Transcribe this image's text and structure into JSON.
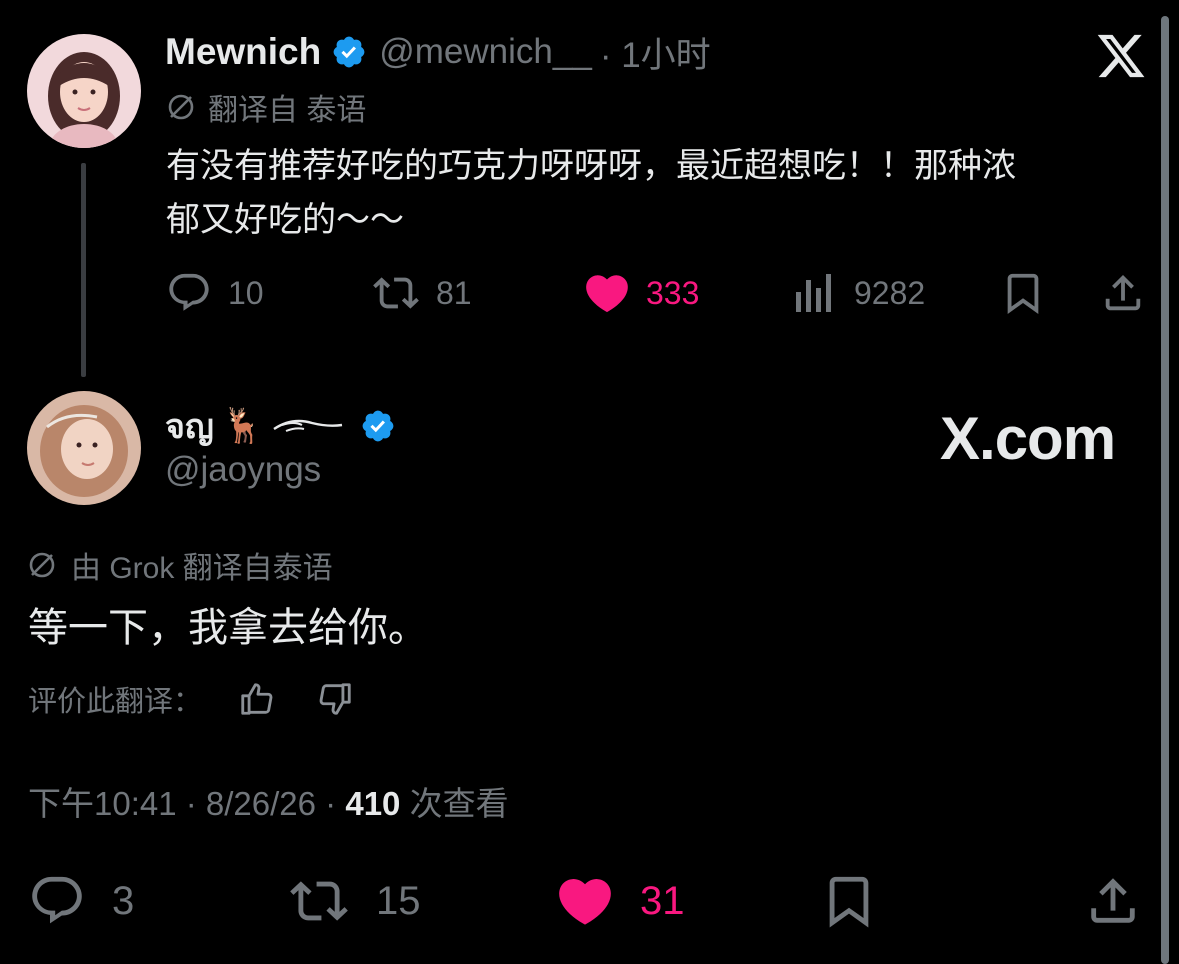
{
  "tweet1": {
    "name": "Mewnich",
    "handle": "@mewnich__",
    "time": "· 1小时",
    "translation_label": "翻译自 泰语",
    "text_line1": "有没有推荐好吃的巧克力呀呀呀，最近超想吃！！那种浓",
    "text_line2": "郁又好吃的～～",
    "replies": "10",
    "retweets": "81",
    "likes": "333",
    "views": "9282"
  },
  "tweet2": {
    "name": "จญ",
    "name_emoji": "🦌",
    "handle": "@jaoyngs",
    "watermark": "X.com",
    "translation_label": "由 Grok 翻译自泰语",
    "text": "等一下，我拿去给你。",
    "rate_label": "评价此翻译：",
    "timestamp": "下午10:41 · 8/26/26 · ",
    "views_count": "410",
    "views_label": " 次查看",
    "replies": "3",
    "retweets": "15",
    "likes": "31"
  },
  "colors": {
    "background": "#000000",
    "text": "#e7e9ea",
    "muted": "#71767b",
    "like": "#f91880",
    "verified": "#1d9bf0"
  },
  "icons": [
    "x-logo-icon",
    "verified-badge-icon",
    "translate-icon",
    "reply-icon",
    "retweet-icon",
    "like-icon",
    "views-icon",
    "bookmark-icon",
    "share-icon",
    "thumbs-up-icon",
    "thumbs-down-icon"
  ]
}
